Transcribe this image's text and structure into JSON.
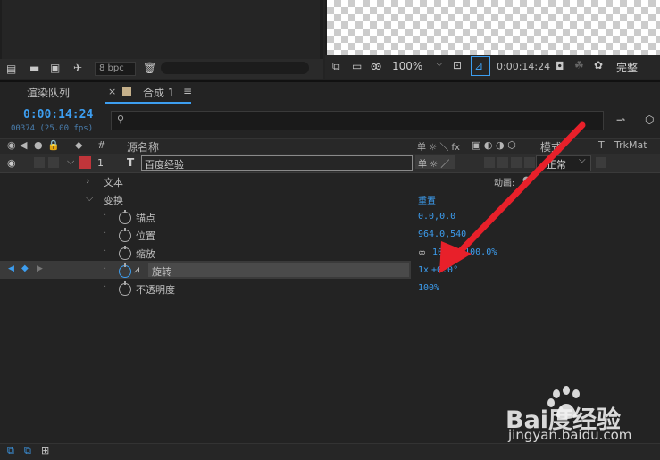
{
  "project": {
    "bpc_label": "8 bpc"
  },
  "viewer": {
    "zoom": "100%",
    "timecode": "0:00:14:24",
    "resolution": "完整"
  },
  "tabs": [
    {
      "label": "渲染队列"
    },
    {
      "label": "合成 1"
    }
  ],
  "time": {
    "current": "0:00:14:24",
    "frames": "00374 (25.00 fps)"
  },
  "columns": {
    "source_name": "源名称",
    "number_sign": "#",
    "switches": "单 ☼ ＼ fx",
    "mode": "模式",
    "t": "T",
    "trkmat": "TrkMat"
  },
  "layer": {
    "index": "1",
    "type_glyph": "T",
    "name": "百度经验",
    "mode_value": "正常",
    "color": "#c0353a"
  },
  "properties": {
    "text_group": "文本",
    "animate_label": "动画:",
    "transform_group": "变换",
    "reset_label": "重置",
    "anchor": {
      "label": "锚点",
      "value": "0.0,0.0"
    },
    "position": {
      "label": "位置",
      "value": "964.0,540"
    },
    "scale": {
      "label": "缩放",
      "value": "100.0,100.0%"
    },
    "rotation": {
      "label": "旋转",
      "value_revs": "1x",
      "value_deg": "+0.0°"
    },
    "opacity": {
      "label": "不透明度",
      "value": "100%"
    }
  },
  "watermark": {
    "brand": "Bai度经验",
    "url": "jingyan.baidu.com"
  },
  "annotation": {
    "arrow_color": "#e8202a"
  }
}
